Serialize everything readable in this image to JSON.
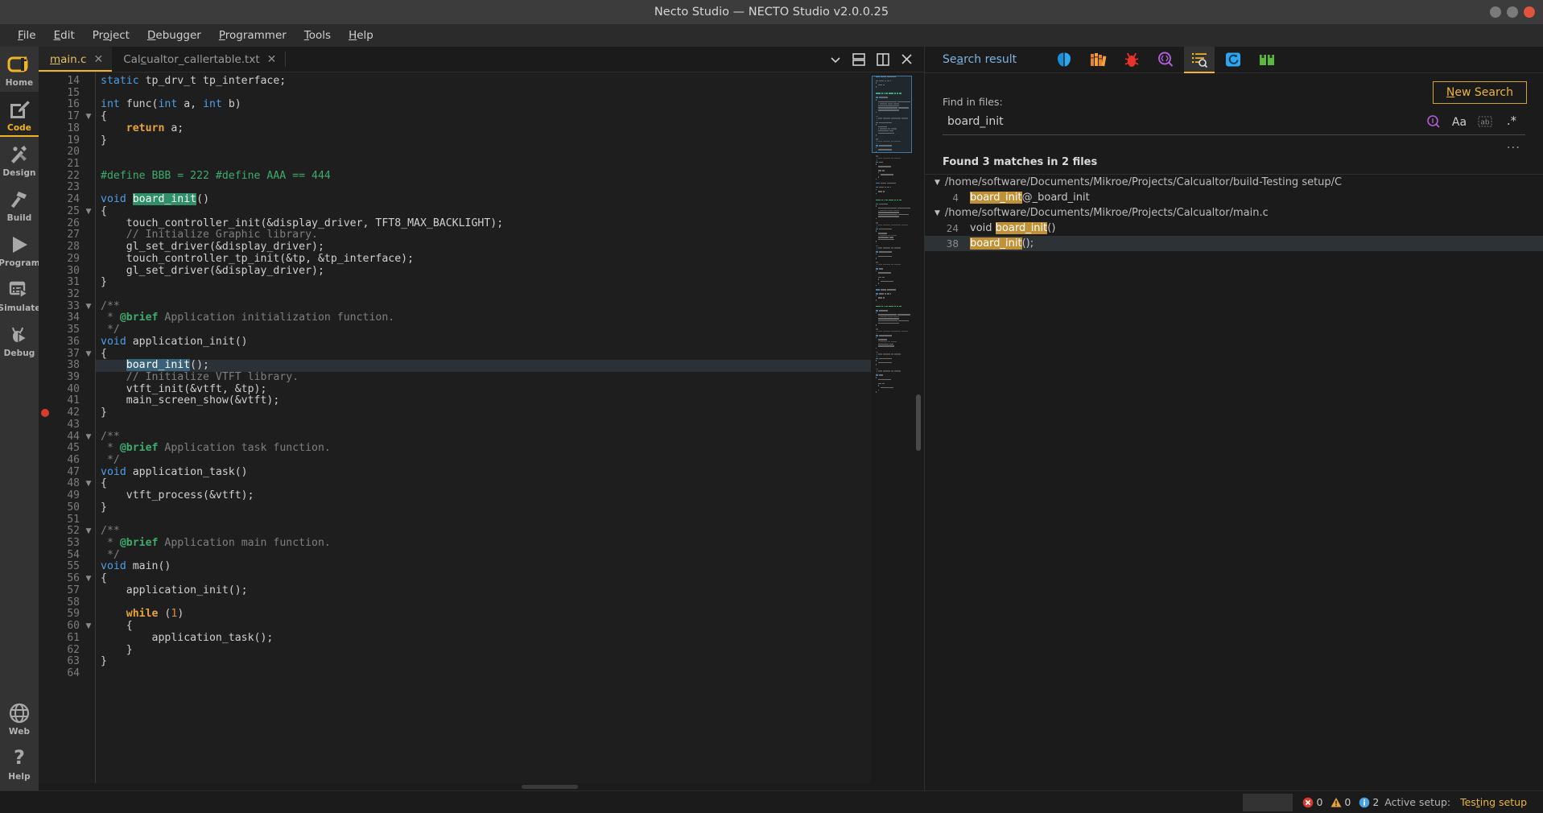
{
  "window": {
    "title": "Necto Studio — NECTO Studio v2.0.0.25",
    "controls": [
      "minimize",
      "maximize",
      "close"
    ]
  },
  "menubar": {
    "items": [
      {
        "label": "File",
        "accel": "F"
      },
      {
        "label": "Edit",
        "accel": "E"
      },
      {
        "label": "Project",
        "accel": "o"
      },
      {
        "label": "Debugger",
        "accel": "D"
      },
      {
        "label": "Programmer",
        "accel": "P"
      },
      {
        "label": "Tools",
        "accel": "T"
      },
      {
        "label": "Help",
        "accel": "H"
      }
    ]
  },
  "rail": {
    "items": [
      {
        "label": "Home",
        "icon": "home-logo-icon",
        "active": false
      },
      {
        "label": "Code",
        "icon": "code-edit-icon",
        "active": true
      },
      {
        "label": "Design",
        "icon": "design-tools-icon",
        "active": false
      },
      {
        "label": "Build",
        "icon": "hammer-icon",
        "active": false
      },
      {
        "label": "Program",
        "icon": "play-icon",
        "active": false
      },
      {
        "label": "Simulate",
        "icon": "simulate-icon",
        "active": false
      },
      {
        "label": "Debug",
        "icon": "bug-play-icon",
        "active": false
      }
    ],
    "bottom_items": [
      {
        "label": "Web",
        "icon": "globe-icon"
      },
      {
        "label": "Help",
        "icon": "question-mark-icon"
      }
    ]
  },
  "editor": {
    "tabs": [
      {
        "label": "main.c",
        "accel": "m",
        "active": true,
        "closable": true
      },
      {
        "label": "Calcualtor_callertable.txt",
        "accel": "c",
        "active": false,
        "closable": true
      }
    ],
    "tab_buttons": [
      {
        "name": "tab-list-chevron",
        "icon": "chevron-down-icon"
      },
      {
        "name": "split-horizontal",
        "icon": "split-horizontal-icon"
      },
      {
        "name": "split-vertical",
        "icon": "split-vertical-icon"
      },
      {
        "name": "close-editor",
        "icon": "close-icon"
      }
    ],
    "first_line_number": 14,
    "current_line": 38,
    "breakpoint_line": 42,
    "fold_lines": [
      17,
      25,
      33,
      37,
      44,
      48,
      52,
      56,
      60
    ],
    "lines": [
      {
        "n": 14,
        "text": "static tp_drv_t tp_interface;"
      },
      {
        "n": 15,
        "text": ""
      },
      {
        "n": 16,
        "text": "int func(int a, int b)"
      },
      {
        "n": 17,
        "text": "{"
      },
      {
        "n": 18,
        "text": "    return a;"
      },
      {
        "n": 19,
        "text": "}"
      },
      {
        "n": 20,
        "text": ""
      },
      {
        "n": 21,
        "text": ""
      },
      {
        "n": 22,
        "text": "#define BBB = 222 #define AAA == 444"
      },
      {
        "n": 23,
        "text": ""
      },
      {
        "n": 24,
        "text": "void board_init()"
      },
      {
        "n": 25,
        "text": "{"
      },
      {
        "n": 26,
        "text": "    touch_controller_init(&display_driver, TFT8_MAX_BACKLIGHT);"
      },
      {
        "n": 27,
        "text": "    // Initialize Graphic library."
      },
      {
        "n": 28,
        "text": "    gl_set_driver(&display_driver);"
      },
      {
        "n": 29,
        "text": "    touch_controller_tp_init(&tp, &tp_interface);"
      },
      {
        "n": 30,
        "text": "    gl_set_driver(&display_driver);"
      },
      {
        "n": 31,
        "text": "}"
      },
      {
        "n": 32,
        "text": ""
      },
      {
        "n": 33,
        "text": "/**"
      },
      {
        "n": 34,
        "text": " * @brief Application initialization function."
      },
      {
        "n": 35,
        "text": " */"
      },
      {
        "n": 36,
        "text": "void application_init()"
      },
      {
        "n": 37,
        "text": "{"
      },
      {
        "n": 38,
        "text": "    board_init();"
      },
      {
        "n": 39,
        "text": "    // Initialize VTFT library."
      },
      {
        "n": 40,
        "text": "    vtft_init(&vtft, &tp);"
      },
      {
        "n": 41,
        "text": "    main_screen_show(&vtft);"
      },
      {
        "n": 42,
        "text": "}"
      },
      {
        "n": 43,
        "text": ""
      },
      {
        "n": 44,
        "text": "/**"
      },
      {
        "n": 45,
        "text": " * @brief Application task function."
      },
      {
        "n": 46,
        "text": " */"
      },
      {
        "n": 47,
        "text": "void application_task()"
      },
      {
        "n": 48,
        "text": "{"
      },
      {
        "n": 49,
        "text": "    vtft_process(&vtft);"
      },
      {
        "n": 50,
        "text": "}"
      },
      {
        "n": 51,
        "text": ""
      },
      {
        "n": 52,
        "text": "/**"
      },
      {
        "n": 53,
        "text": " * @brief Application main function."
      },
      {
        "n": 54,
        "text": " */"
      },
      {
        "n": 55,
        "text": "void main()"
      },
      {
        "n": 56,
        "text": "{"
      },
      {
        "n": 57,
        "text": "    application_init();"
      },
      {
        "n": 58,
        "text": ""
      },
      {
        "n": 59,
        "text": "    while (1)"
      },
      {
        "n": 60,
        "text": "    {"
      },
      {
        "n": 61,
        "text": "        application_task();"
      },
      {
        "n": 62,
        "text": "    }"
      },
      {
        "n": 63,
        "text": "}"
      },
      {
        "n": 64,
        "text": ""
      }
    ]
  },
  "panel": {
    "title": "Search result",
    "title_accel": "a",
    "tool_icons": [
      {
        "name": "brain-icon",
        "selected": false
      },
      {
        "name": "library-books-icon",
        "selected": false
      },
      {
        "name": "bug-icon",
        "selected": false
      },
      {
        "name": "magnifier-code-icon",
        "selected": false
      },
      {
        "name": "search-result-list-icon",
        "selected": true
      },
      {
        "name": "refresh-link-icon",
        "selected": false
      },
      {
        "name": "packages-icon",
        "selected": false
      }
    ],
    "new_search_label": "New Search",
    "new_search_accel": "N",
    "find_label": "Find in files:",
    "find_value": "board_init",
    "find_placeholder": "Find in files",
    "find_buttons": [
      {
        "name": "search-in-selection-icon",
        "active": true
      },
      {
        "name": "match-case-icon",
        "label": "Aa",
        "active": false
      },
      {
        "name": "whole-word-icon",
        "label": "ab",
        "active": false
      },
      {
        "name": "regex-icon",
        "label": ".*",
        "active": false
      }
    ],
    "more_options": "...",
    "found_summary": "Found 3 matches in 2 files",
    "groups": [
      {
        "path": "/home/software/Documents/Mikroe/Projects/Calcualtor/build-Testing setup/C",
        "expanded": true,
        "hits": [
          {
            "line": "4",
            "prefix": "",
            "match": "board_init",
            "suffix": "@_board_init",
            "selected": false
          }
        ]
      },
      {
        "path": "/home/software/Documents/Mikroe/Projects/Calcualtor/main.c",
        "expanded": true,
        "hits": [
          {
            "line": "24",
            "prefix": "void ",
            "match": "board_init",
            "suffix": "()",
            "selected": false
          },
          {
            "line": "38",
            "prefix": "",
            "match": "board_init",
            "suffix": "();",
            "selected": true
          }
        ]
      }
    ]
  },
  "statusbar": {
    "errors": "0",
    "warnings": "0",
    "infos": "2",
    "active_setup_label": "Active setup:",
    "active_setup_value": "Testing setup",
    "active_setup_accel": "t"
  },
  "colors": {
    "accent": "#f2b324",
    "error": "#d73a2e",
    "warning": "#e8a33d",
    "info": "#4aa3df",
    "match_highlight": "#c09136",
    "symbol_highlight": "#2f8f68",
    "selection": "#3a617a"
  }
}
